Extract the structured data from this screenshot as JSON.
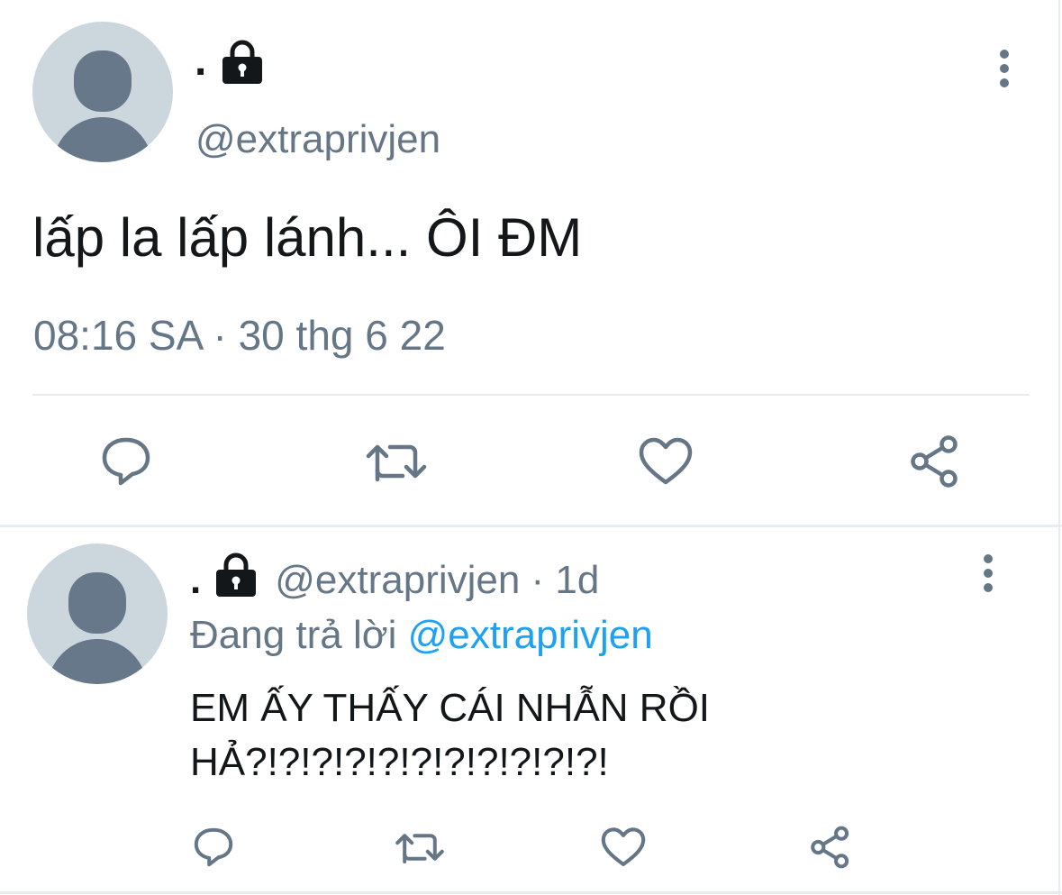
{
  "main_tweet": {
    "display_name": ".",
    "handle": "@extraprivjen",
    "text": "lấp la lấp lánh... ÔI ĐM",
    "timestamp": "08:16 SA · 30 thg 6 22",
    "actions": [
      "reply-icon",
      "retweet-icon",
      "like-icon",
      "share-icon"
    ]
  },
  "reply_tweet": {
    "display_name": ".",
    "handle_time": "@extraprivjen · 1d",
    "replying_prefix": "Đang trả lời",
    "replying_to": "@extraprivjen",
    "text_line1": "EM ẤY THẤY CÁI NHẪN RỒI",
    "text_line2": "HẢ?!?!?!?!?!?!?!?!?!?!?!",
    "actions": [
      "reply-icon",
      "retweet-icon",
      "like-icon",
      "share-icon"
    ]
  },
  "colors": {
    "muted": "#657786",
    "link": "#1da1f2",
    "avatar_bg": "#ccd6dd",
    "avatar_fg": "#66788a",
    "divider": "#e6ecf0",
    "text": "#14171a"
  }
}
